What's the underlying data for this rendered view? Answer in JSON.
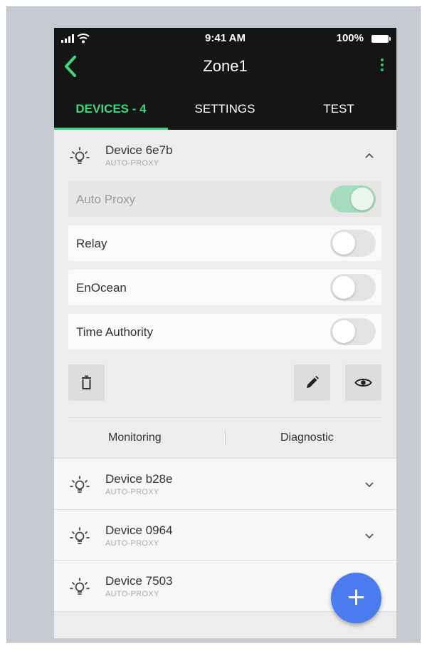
{
  "status": {
    "time": "9:41 AM",
    "battery": "100%"
  },
  "header": {
    "title": "Zone1"
  },
  "tabs": [
    {
      "label": "DEVICES - 4",
      "active": true
    },
    {
      "label": "SETTINGS",
      "active": false
    },
    {
      "label": "TEST",
      "active": false
    }
  ],
  "expanded_device": {
    "name": "Device 6e7b",
    "mode": "AUTO-PROXY",
    "options": [
      {
        "label": "Auto Proxy",
        "on": true,
        "disabled": true
      },
      {
        "label": "Relay",
        "on": false,
        "disabled": false
      },
      {
        "label": "EnOcean",
        "on": false,
        "disabled": false
      },
      {
        "label": "Time Authority",
        "on": false,
        "disabled": false
      }
    ],
    "sub_tabs": {
      "monitoring": "Monitoring",
      "diagnostic": "Diagnostic"
    }
  },
  "devices": [
    {
      "name": "Device b28e",
      "mode": "AUTO-PROXY"
    },
    {
      "name": "Device 0964",
      "mode": "AUTO-PROXY"
    },
    {
      "name": "Device 7503",
      "mode": "AUTO-PROXY"
    }
  ],
  "fab": {
    "label": "+"
  },
  "icons": [
    "back-arrow-icon",
    "more-vertical-icon",
    "bulb-icon",
    "chevron-up-icon",
    "chevron-down-icon",
    "trash-icon",
    "pencil-icon",
    "eye-icon",
    "plus-icon"
  ],
  "colors": {
    "accent": "#3fd67f",
    "header_bg": "#151515",
    "fab": "#4a7cf0",
    "toggle_on": "#a5dcbd"
  }
}
